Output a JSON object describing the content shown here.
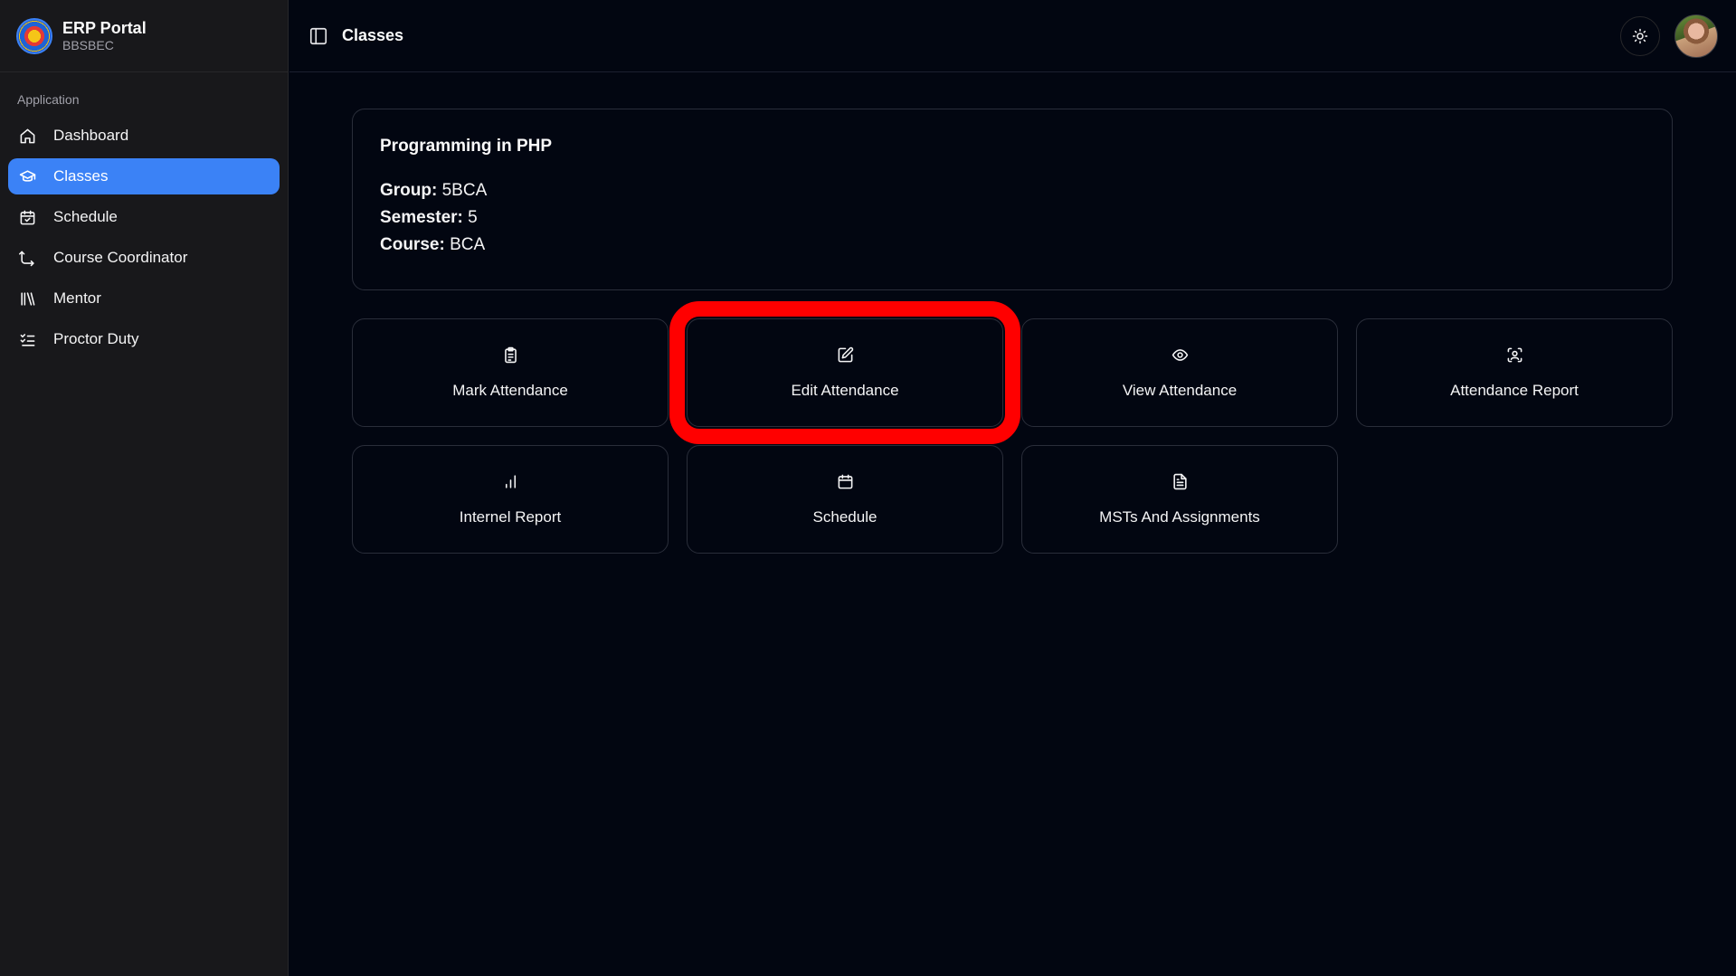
{
  "brand": {
    "title": "ERP Portal",
    "subtitle": "BBSBEC",
    "logo_icon": "college-seal-logo"
  },
  "sidebar": {
    "section_label": "Application",
    "items": [
      {
        "label": "Dashboard",
        "icon": "home-icon",
        "active": false
      },
      {
        "label": "Classes",
        "icon": "graduation-cap-icon",
        "active": true
      },
      {
        "label": "Schedule",
        "icon": "calendar-check-icon",
        "active": false
      },
      {
        "label": "Course Coordinator",
        "icon": "route-icon",
        "active": false
      },
      {
        "label": "Mentor",
        "icon": "library-icon",
        "active": false
      },
      {
        "label": "Proctor Duty",
        "icon": "list-checks-icon",
        "active": false
      }
    ]
  },
  "header": {
    "title": "Classes",
    "toggle_icon": "panel-left-icon",
    "theme_icon": "sun-icon"
  },
  "class_info": {
    "title": "Programming in PHP",
    "group_label": "Group:",
    "group_value": "5BCA",
    "semester_label": "Semester:",
    "semester_value": "5",
    "course_label": "Course:",
    "course_value": "BCA"
  },
  "actions": [
    {
      "label": "Mark Attendance",
      "icon": "clipboard-list-icon",
      "highlighted": false
    },
    {
      "label": "Edit Attendance",
      "icon": "square-pen-icon",
      "highlighted": true
    },
    {
      "label": "View Attendance",
      "icon": "eye-icon",
      "highlighted": false
    },
    {
      "label": "Attendance Report",
      "icon": "scan-face-icon",
      "highlighted": false
    },
    {
      "label": "Internel Report",
      "icon": "bar-chart-icon",
      "highlighted": false
    },
    {
      "label": "Schedule",
      "icon": "calendar-icon",
      "highlighted": false
    },
    {
      "label": "MSTs And Assignments",
      "icon": "file-text-icon",
      "highlighted": false
    }
  ],
  "colors": {
    "accent": "#3b82f6",
    "highlight": "#ff0000",
    "background": "#020611",
    "sidebar": "#18181b"
  }
}
